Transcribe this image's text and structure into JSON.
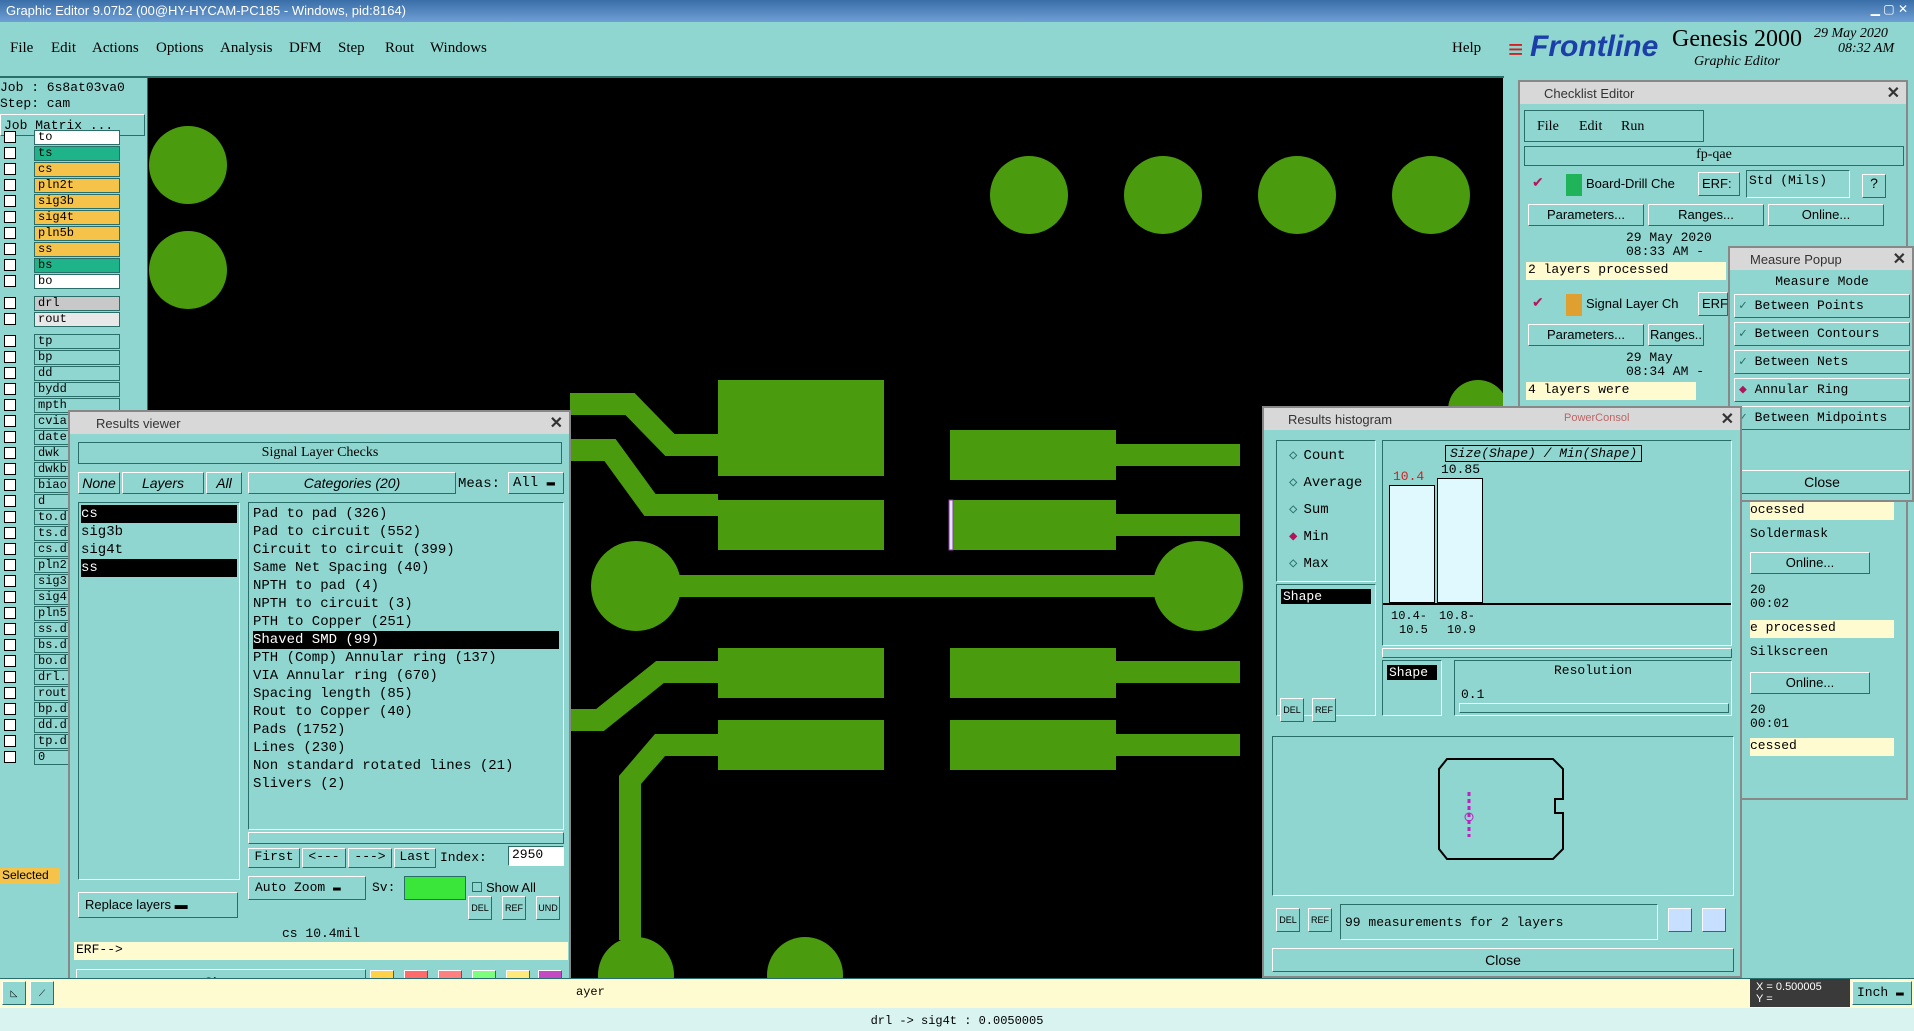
{
  "window": {
    "title": "Graphic Editor 9.07b2 (00@HY-HYCAM-PC185 - Windows, pid:8164)"
  },
  "menu": [
    "File",
    "Edit",
    "Actions",
    "Options",
    "Analysis",
    "DFM",
    "Step",
    "Rout",
    "Windows"
  ],
  "help": "Help",
  "brand": {
    "logo": "Frontline",
    "product": "Genesis 2000",
    "subtitle": "Graphic Editor",
    "date": "29 May 2020",
    "time": "08:32 AM"
  },
  "job": {
    "job_label": "Job : 6s8at03va0",
    "step_label": "Step: cam",
    "matrix_button": "Job Matrix ..."
  },
  "layers_top": [
    {
      "name": "to",
      "color": "#ffffff"
    },
    {
      "name": "ts",
      "color": "#1fb38a"
    },
    {
      "name": "cs",
      "color": "#f5c24a"
    },
    {
      "name": "pln2t",
      "color": "#f5c24a"
    },
    {
      "name": "sig3b",
      "color": "#f5c24a"
    },
    {
      "name": "sig4t",
      "color": "#f5c24a"
    },
    {
      "name": "pln5b",
      "color": "#f5c24a"
    },
    {
      "name": "ss",
      "color": "#f5c24a"
    },
    {
      "name": "bs",
      "color": "#1fb38a"
    },
    {
      "name": "bo",
      "color": "#ffffff"
    }
  ],
  "layers_mid": [
    {
      "name": "drl",
      "color": "#c8c8c8"
    },
    {
      "name": "rout",
      "color": "#e8e8e8"
    }
  ],
  "layers_bottom": [
    "tp",
    "bp",
    "dd",
    "bydd",
    "mpth",
    "cvia",
    "date",
    "dwk",
    "dwkb",
    "biao",
    "d",
    "to.d",
    "ts.d",
    "cs.d",
    "pln2",
    "sig3",
    "sig4",
    "pln5",
    "ss.d",
    "bs.d",
    "bo.d",
    "drl.",
    "rout",
    "bp.d",
    "dd.d",
    "tp.d",
    "0"
  ],
  "selected_label": "Selected",
  "results_viewer": {
    "title": "Results viewer",
    "heading": "Signal Layer Checks",
    "none": "None",
    "layers": "Layers",
    "all": "All",
    "categories_label": "Categories (20)",
    "meas_label": "Meas:",
    "meas_value": "All",
    "layer_list": [
      "cs",
      "sig3b",
      "sig4t",
      "ss"
    ],
    "categories": [
      "Pad to pad (326)",
      "Pad to circuit (552)",
      "Circuit to circuit (399)",
      "Same Net Spacing (40)",
      "NPTH to pad (4)",
      "NPTH to circuit (3)",
      "PTH to Copper (251)",
      "Shaved SMD (99)",
      "PTH (Comp) Annular ring (137)",
      "VIA Annular ring (670)",
      "Spacing length (85)",
      "Rout to Copper (40)",
      "Pads (1752)",
      "Lines (230)",
      "Non standard rotated lines (21)",
      "Slivers (2)"
    ],
    "first": "First",
    "prev": "<---",
    "next": "--->",
    "last": "Last",
    "index_label": "Index:",
    "index_value": "2950",
    "auto_zoom": "Auto Zoom",
    "sv_label": "Sv:",
    "show_all": "Show All",
    "replace_layers": "Replace layers",
    "status": "cs 10.4mil",
    "erf": "ERF-->",
    "close": "Close"
  },
  "checklist": {
    "title": "Checklist Editor",
    "menu": [
      "File",
      "Edit",
      "Run"
    ],
    "name": "fp-qae",
    "items": [
      {
        "name": "Board-Drill Che",
        "erf": "ERF:",
        "std": "Std (Mils)",
        "params": "Parameters...",
        "ranges": "Ranges...",
        "online": "Online...",
        "date": "29 May 2020",
        "time": "08:33 AM -",
        "result": "2 layers processed"
      },
      {
        "name": "Signal Layer Ch",
        "erf": "ERF",
        "params": "Parameters...",
        "ranges": "Ranges..",
        "date": "29 May",
        "time": "08:34 AM -",
        "result": "4 layers were processe"
      }
    ],
    "right_fragments": [
      "ocessed",
      "Soldermask",
      "Online...",
      "20",
      "00:02",
      "e processed",
      "Silkscreen",
      "Online...",
      "20",
      "00:01",
      "cessed"
    ]
  },
  "measure": {
    "title": "Measure Popup",
    "mode": "Measure Mode",
    "options": [
      "Between Points",
      "Between Contours",
      "Between Nets",
      "Annular Ring",
      "Between Midpoints"
    ],
    "active": "Annular Ring",
    "close": "Close"
  },
  "histogram": {
    "title": "Results histogram",
    "stats": [
      "Count",
      "Average",
      "Sum",
      "Min",
      "Max"
    ],
    "active_stat": "Min",
    "shape": "Shape",
    "chart_title": "Size(Shape) / Min(Shape)",
    "bars": [
      {
        "label_top": "10.4",
        "range": "10.4-",
        "range2": "10.5",
        "value": 10.4
      },
      {
        "label_top": "10.85",
        "range": "10.8-",
        "range2": "10.9",
        "value": 10.85
      }
    ],
    "resolution_label": "Resolution",
    "resolution_value": "0.1",
    "summary": "99 measurements for 2 layers",
    "close": "Close"
  },
  "hidden_dialog": "PowerConsol",
  "units": "Inch",
  "coords": {
    "x_label": "X =",
    "x_value": "0.500005",
    "y_label": "Y ="
  },
  "bottom_layer_frag": "ayer",
  "status_line": "drl -> sig4t : 0.0050005"
}
